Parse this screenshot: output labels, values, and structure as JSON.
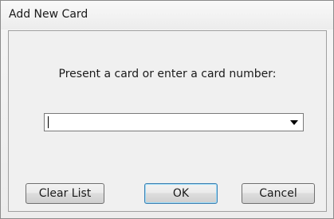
{
  "window": {
    "title": "Add New Card"
  },
  "dialog": {
    "prompt": "Present a card or enter a card number:",
    "card_input": {
      "value": "",
      "placeholder": ""
    }
  },
  "buttons": {
    "clear_list": "Clear List",
    "ok": "OK",
    "cancel": "Cancel"
  },
  "icons": {
    "dropdown": "chevron-down-icon"
  },
  "colors": {
    "default_button_border": "#3c7fb1",
    "window_background": "#f0f0f0"
  }
}
